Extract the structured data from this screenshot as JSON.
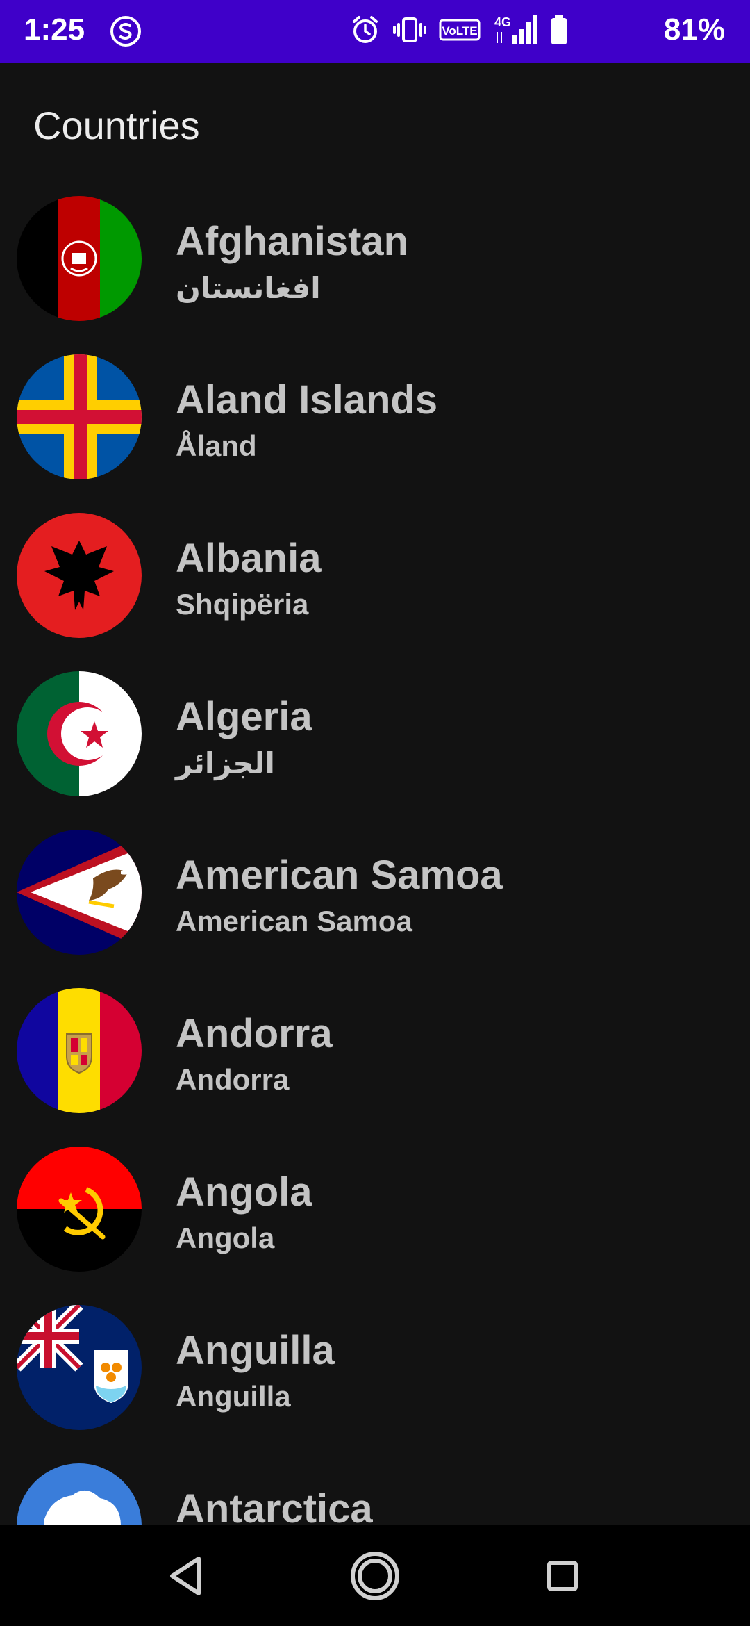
{
  "status_bar": {
    "time": "1:25",
    "battery_percent": "81%",
    "network": "4G",
    "volte_label": "VoLTE",
    "background_color": "#3f00c9",
    "icons": [
      "s-app-icon",
      "alarm-icon",
      "vibrate-icon",
      "volte-icon",
      "signal-icon",
      "battery-icon"
    ]
  },
  "page": {
    "title": "Countries"
  },
  "countries": [
    {
      "name": "Afghanistan",
      "native": "افغانستان",
      "flag": "afghanistan-flag"
    },
    {
      "name": "Aland Islands",
      "native": "Åland",
      "flag": "aland-flag"
    },
    {
      "name": "Albania",
      "native": "Shqipëria",
      "flag": "albania-flag"
    },
    {
      "name": "Algeria",
      "native": "الجزائر",
      "flag": "algeria-flag"
    },
    {
      "name": "American Samoa",
      "native": "American Samoa",
      "flag": "american-samoa-flag"
    },
    {
      "name": "Andorra",
      "native": "Andorra",
      "flag": "andorra-flag"
    },
    {
      "name": "Angola",
      "native": "Angola",
      "flag": "angola-flag"
    },
    {
      "name": "Anguilla",
      "native": "Anguilla",
      "flag": "anguilla-flag"
    },
    {
      "name": "Antarctica",
      "native": "",
      "flag": "antarctica-flag"
    }
  ],
  "nav_bar": {
    "buttons": [
      "back-icon",
      "home-icon",
      "recents-icon"
    ]
  }
}
